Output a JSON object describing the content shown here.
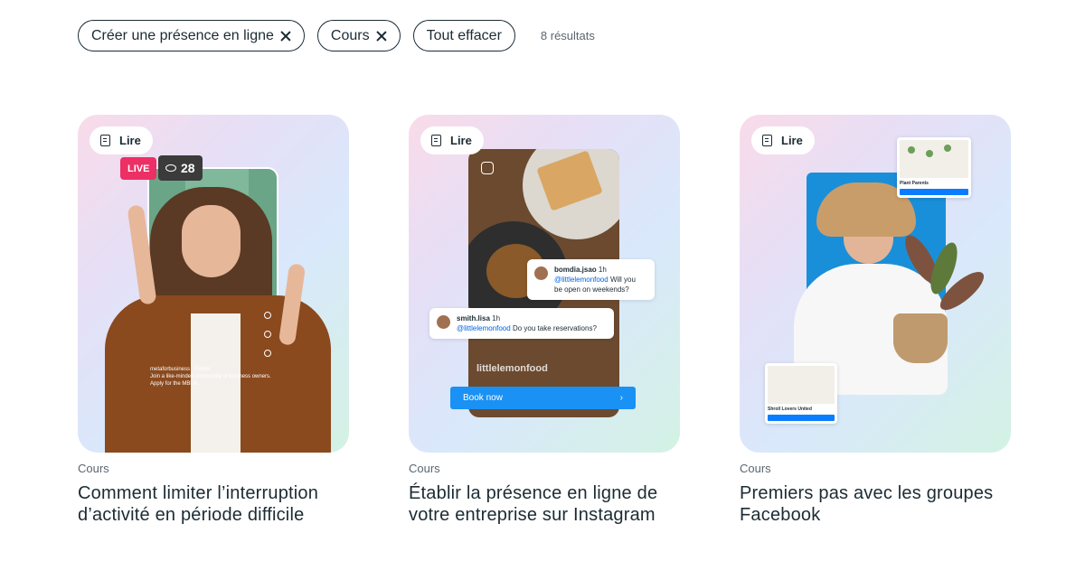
{
  "filters": {
    "chips": [
      {
        "label": "Créer une présence en ligne"
      },
      {
        "label": "Cours"
      }
    ],
    "clear_label": "Tout effacer",
    "results": "8 résultats"
  },
  "cards": [
    {
      "badge": "Lire",
      "category": "Cours",
      "title": "Comment limiter l’interruption d’activité en période difficile",
      "live_label": "LIVE",
      "viewers": "28",
      "account": "metaforbusiness",
      "follow": "Follow",
      "caption": "Join a like-minded community of business owners. Apply for the MBLN."
    },
    {
      "badge": "Lire",
      "category": "Cours",
      "title": "Établir la présence en ligne de votre entreprise sur Instagram",
      "comment1_user": "bomdia.jsao",
      "comment1_time": "1h",
      "comment1_tag": "@littlelemonfood",
      "comment1_text": "Will you be open on weekends?",
      "comment2_user": "smith.lisa",
      "comment2_time": "1h",
      "comment2_tag": "@littlelemonfood",
      "comment2_text": "Do you take reservations?",
      "handle": "littlelemonfood",
      "book_label": "Book now"
    },
    {
      "badge": "Lire",
      "category": "Cours",
      "title": "Premiers pas avec les groupes Facebook",
      "shop1_name": "Plant Parents",
      "shop2_name": "Shroll Lovers United"
    }
  ]
}
